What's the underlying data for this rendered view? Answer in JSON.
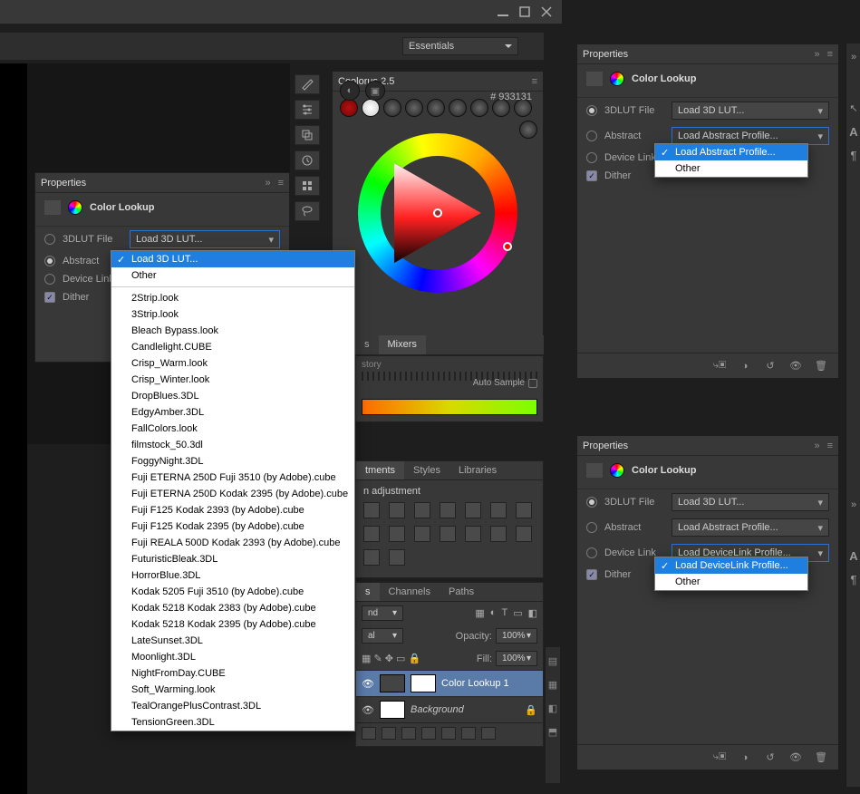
{
  "workspace": {
    "selected": "Essentials"
  },
  "coolorus": {
    "title": "Coolorus 2.5",
    "hex": "# 933131"
  },
  "mixers": {
    "tabs": [
      "s",
      "Mixers"
    ],
    "active": "Mixers",
    "label_story": "story",
    "autosample": "Auto Sample"
  },
  "adjust": {
    "tabs": [
      "tments",
      "Styles",
      "Libraries"
    ],
    "heading": "n adjustment"
  },
  "layers": {
    "tabs": [
      "s",
      "Channels",
      "Paths"
    ],
    "blend": "nd",
    "opacity_label": "Opacity:",
    "opacity": "100%",
    "fill_label": "Fill:",
    "fill": "100%",
    "mode2": "al",
    "items": [
      {
        "name": "Color Lookup 1",
        "active": true
      },
      {
        "name": "Background",
        "active": false,
        "locked": true
      }
    ]
  },
  "properties": {
    "title_tab": "Properties",
    "title": "Color Lookup",
    "lut_label": "3DLUT File",
    "abstract_label": "Abstract",
    "device_label": "Device Link",
    "dither_label": "Dither",
    "lut_dropdown": "Load 3D LUT...",
    "abstract_dropdown": "Load Abstract Profile...",
    "device_dropdown": "Load DeviceLink Profile..."
  },
  "lut_options": {
    "selected": "Load 3D LUT...",
    "other": "Other",
    "list": [
      "2Strip.look",
      "3Strip.look",
      "Bleach Bypass.look",
      "Candlelight.CUBE",
      "Crisp_Warm.look",
      "Crisp_Winter.look",
      "DropBlues.3DL",
      "EdgyAmber.3DL",
      "FallColors.look",
      "filmstock_50.3dl",
      "FoggyNight.3DL",
      "Fuji ETERNA 250D Fuji 3510 (by Adobe).cube",
      "Fuji ETERNA 250D Kodak 2395 (by Adobe).cube",
      "Fuji F125 Kodak 2393 (by Adobe).cube",
      "Fuji F125 Kodak 2395 (by Adobe).cube",
      "Fuji REALA 500D Kodak 2393 (by Adobe).cube",
      "FuturisticBleak.3DL",
      "HorrorBlue.3DL",
      "Kodak 5205 Fuji 3510 (by Adobe).cube",
      "Kodak 5218 Kodak 2383 (by Adobe).cube",
      "Kodak 5218 Kodak 2395 (by Adobe).cube",
      "LateSunset.3DL",
      "Moonlight.3DL",
      "NightFromDay.CUBE",
      "Soft_Warming.look",
      "TealOrangePlusContrast.3DL",
      "TensionGreen.3DL"
    ]
  },
  "abstract_options": {
    "selected": "Load Abstract Profile...",
    "other": "Other"
  },
  "device_options": {
    "selected": "Load DeviceLink Profile...",
    "other": "Other"
  },
  "right_labels": {
    "a": "A",
    "para": "¶"
  }
}
